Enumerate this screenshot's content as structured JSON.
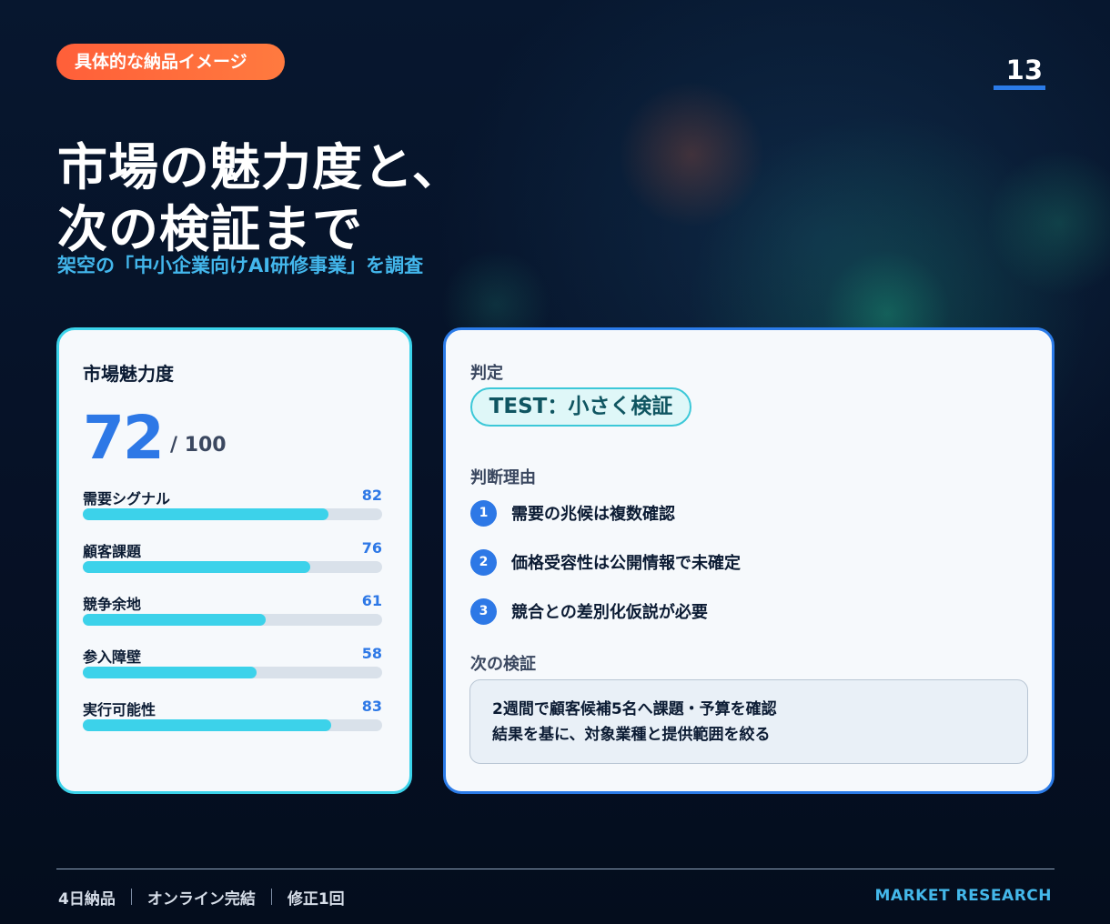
{
  "header": {
    "tag": "具体的な納品イメージ",
    "page_number": "13",
    "title_line1": "市場の魅力度と、",
    "title_line2": "次の検証まで",
    "subtitle": "架空の「中小企業向けAI研修事業」を調査"
  },
  "score_card": {
    "label": "市場魅力度",
    "score": "72",
    "max": "/ 100",
    "metrics": [
      {
        "name": "需要シグナル",
        "value": "82",
        "percent": 82
      },
      {
        "name": "顧客課題",
        "value": "76",
        "percent": 76
      },
      {
        "name": "競争余地",
        "value": "61",
        "percent": 61
      },
      {
        "name": "参入障壁",
        "value": "58",
        "percent": 58
      },
      {
        "name": "実行可能性",
        "value": "83",
        "percent": 83
      }
    ]
  },
  "verdict_card": {
    "verdict_label": "判定",
    "verdict": "TEST：小さく検証",
    "reasons_label": "判断理由",
    "reasons": [
      {
        "num": "1",
        "text": "需要の兆候は複数確認"
      },
      {
        "num": "2",
        "text": "価格受容性は公開情報で未確定"
      },
      {
        "num": "3",
        "text": "競合との差別化仮説が必要"
      }
    ],
    "next_label": "次の検証",
    "next_lines": [
      "2週間で顧客候補5名へ課題・予算を確認",
      "結果を基に、対象業種と提供範囲を絞る"
    ]
  },
  "footer": {
    "items": [
      "4日納品",
      "オンライン完結",
      "修正1回"
    ],
    "brand": "MARKET RESEARCH"
  },
  "colors": {
    "accent_orange": "#ff5f39",
    "accent_blue": "#2d78e6",
    "accent_cyan": "#3cd2ea",
    "background": "#061126"
  }
}
